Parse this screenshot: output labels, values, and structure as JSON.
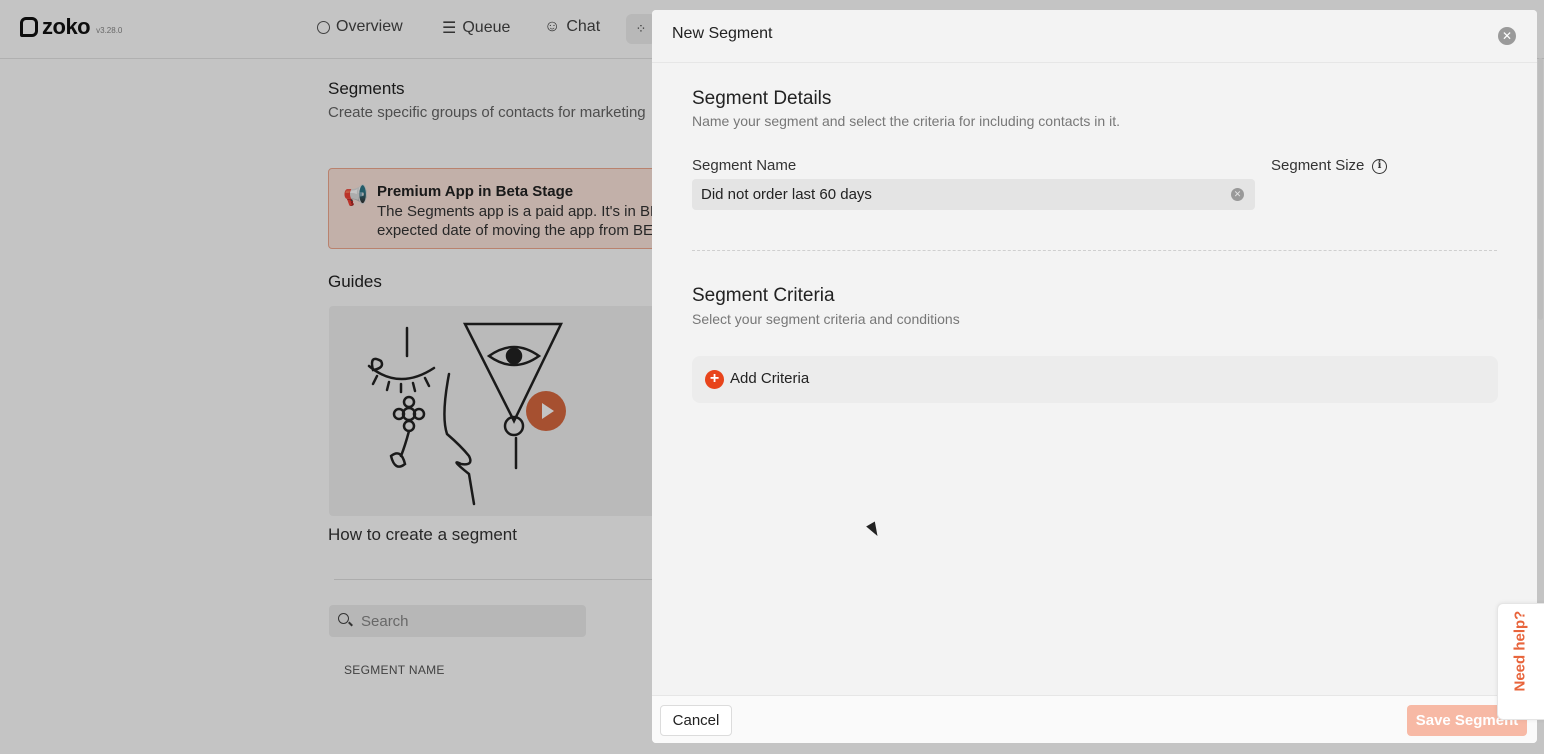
{
  "app": {
    "logo": "zoko",
    "version": "v3.28.0",
    "nav": {
      "overview": "Overview",
      "queue": "Queue",
      "chat": "Chat"
    }
  },
  "page": {
    "title": "Segments",
    "subtitle": "Create specific groups of contacts for marketing",
    "beta": {
      "title": "Premium App in Beta Stage",
      "line1": "The Segments app is a paid app. It's in BE",
      "line2": "expected date of moving the app from BE"
    },
    "guides_title": "Guides",
    "guide_caption": "How to create a segment",
    "search_placeholder": "Search",
    "column_header": "SEGMENT NAME"
  },
  "modal": {
    "title": "New Segment",
    "details_title": "Segment Details",
    "details_subtitle": "Name your segment and select the criteria for including contacts in it.",
    "name_label": "Segment Name",
    "name_value": "Did not order last 60 days",
    "size_label": "Segment Size",
    "criteria_title": "Segment Criteria",
    "criteria_subtitle": "Select your segment criteria and conditions",
    "add_criteria": "Add Criteria",
    "cancel": "Cancel",
    "save": "Save Segment"
  },
  "help": "Need help?",
  "colors": {
    "accent": "#e8441b",
    "beta_bg": "#fde5dc",
    "help_text": "#e8643b"
  }
}
